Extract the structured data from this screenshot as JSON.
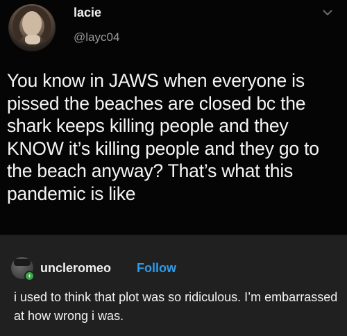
{
  "post": {
    "display_name": "lacie",
    "handle": "@layc04",
    "menu_icon": "chevron-down-icon",
    "text": "You know in JAWS when everyone is pissed the beaches are closed bc the shark keeps killing people and they KNOW it’s killing people and they go to the beach anyway? That’s what this pandemic is like"
  },
  "reply": {
    "username": "uncleromeo",
    "follow_label": "Follow",
    "text": "i used to think that plot was so ridiculous. I’m embarrassed at how wrong i was."
  },
  "colors": {
    "background": "#000000",
    "reply_background": "#202020",
    "follow_accent": "#2f9bea",
    "badge_green": "#3fa64a"
  }
}
